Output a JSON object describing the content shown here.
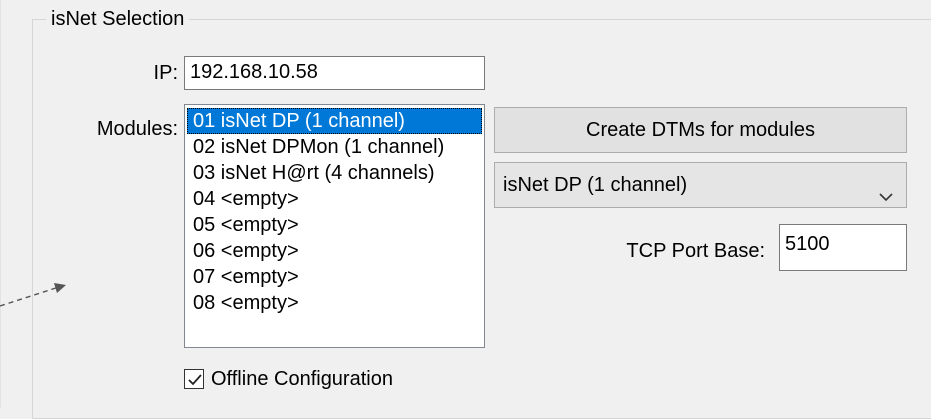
{
  "groupbox": {
    "title": "isNet Selection"
  },
  "ip": {
    "label": "IP:",
    "value": "192.168.10.58"
  },
  "modules": {
    "label": "Modules:",
    "items": [
      "01 isNet DP (1 channel)",
      "02 isNet DPMon (1 channel)",
      "03 isNet H@rt (4 channels)",
      "04 <empty>",
      "05 <empty>",
      "06 <empty>",
      "07 <empty>",
      "08 <empty>"
    ],
    "selected_index": 0
  },
  "create_dtms_button": {
    "label": "Create DTMs for modules"
  },
  "module_type_combo": {
    "value": "isNet DP (1 channel)",
    "icon": "chevron-down-icon"
  },
  "tcp_port_base": {
    "label": "TCP Port Base:",
    "value": "5100"
  },
  "offline_configuration": {
    "label": "Offline Configuration",
    "checked": true
  },
  "colors": {
    "selection": "#0078d7",
    "window_bg": "#f0f0f0"
  }
}
